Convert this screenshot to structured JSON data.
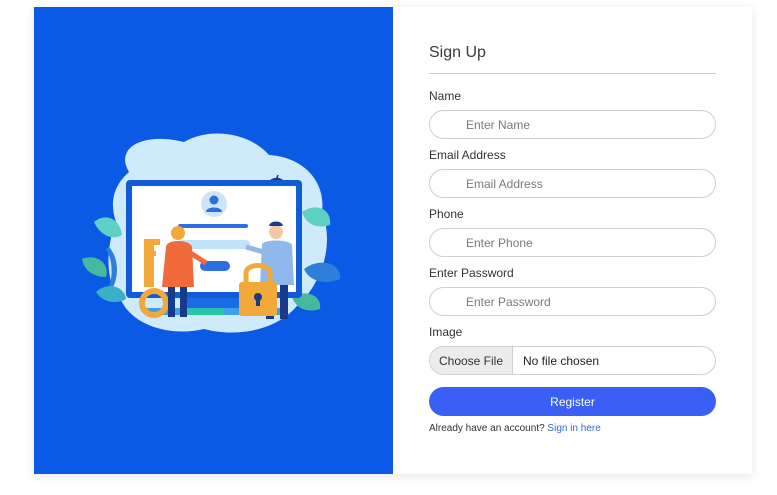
{
  "form": {
    "title": "Sign Up",
    "fields": [
      {
        "label": "Name",
        "placeholder": "Enter Name"
      },
      {
        "label": "Email Address",
        "placeholder": "Email Address"
      },
      {
        "label": "Phone",
        "placeholder": "Enter Phone"
      },
      {
        "label": "Enter Password",
        "placeholder": "Enter Password"
      }
    ],
    "image": {
      "label": "Image",
      "button_label": "Choose File",
      "status": "No file chosen"
    },
    "register_label": "Register",
    "account_prompt": "Already have an account?",
    "signin_link": "Sign in here"
  },
  "illustration": {
    "icons": [
      "monitor-icon",
      "user-avatar-icon",
      "key-icon",
      "padlock-icon",
      "leaf-icon"
    ]
  },
  "colors": {
    "panel_blue": "#0a5ae6",
    "button_blue": "#3a5ff5",
    "link_blue": "#2b6be0"
  }
}
